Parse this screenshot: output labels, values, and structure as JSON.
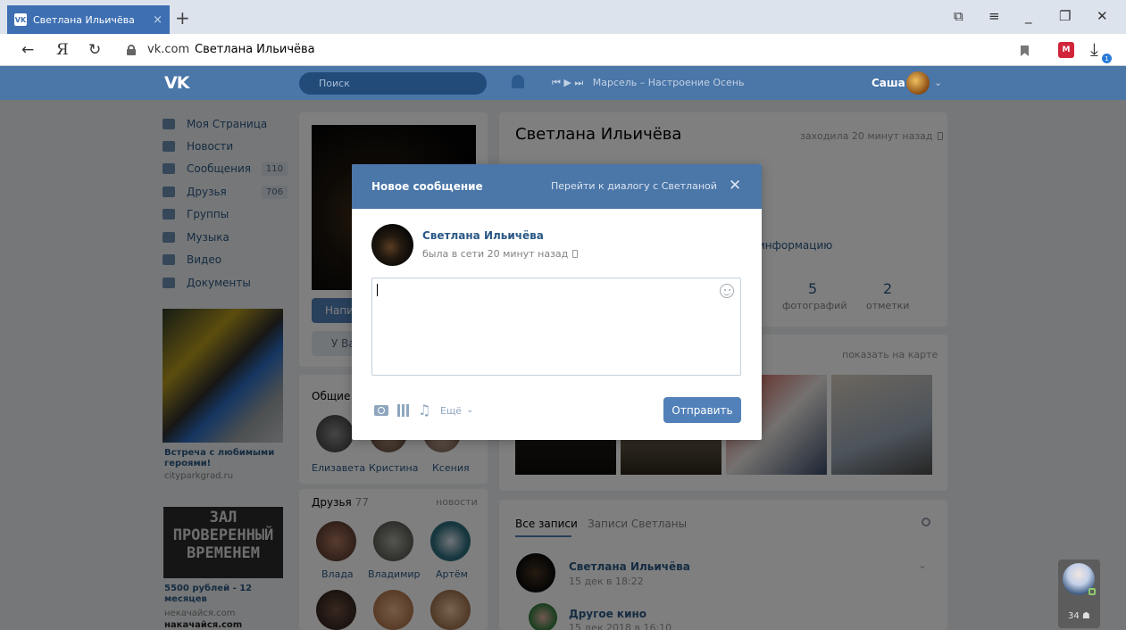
{
  "browser": {
    "tab_title": "Светлана Ильичёва",
    "tab_favicon": "VK",
    "tab_close": "×",
    "new_tab": "+",
    "url_domain": "vk.com",
    "url_title": "Светлана Ильичёва",
    "ext_label": "M",
    "download_badge": "1"
  },
  "vk": {
    "logo": "VK",
    "search_placeholder": "Поиск",
    "player_track": "Марсель – Настроение Осень",
    "user_name": "Саша",
    "menu": [
      {
        "label": "Моя Страница",
        "count": ""
      },
      {
        "label": "Новости",
        "count": ""
      },
      {
        "label": "Сообщения",
        "count": "110"
      },
      {
        "label": "Друзья",
        "count": "706"
      },
      {
        "label": "Группы",
        "count": ""
      },
      {
        "label": "Музыка",
        "count": ""
      },
      {
        "label": "Видео",
        "count": ""
      },
      {
        "label": "Документы",
        "count": ""
      }
    ],
    "ads": [
      {
        "title": "Встреча с любимыми героями!",
        "site": "cityparkgrad.ru"
      },
      {
        "title": "5500 рублей - 12 месяцев",
        "site": "некачайся.com",
        "site2": "накачайся.com",
        "img_text": "ЗАЛ ПРОВЕРЕННЫЙ ВРЕМЕНЕМ"
      }
    ],
    "profile": {
      "name": "Светлана Ильичёва",
      "online": "заходила 20 минут назад",
      "write_button": "Написать",
      "sec_button": "У Вас",
      "info_link": "информацию",
      "photos_count": "5",
      "photos_label": "фотографий",
      "marks_count": "2",
      "marks_label": "отметки",
      "map_link": "показать на карте"
    },
    "common_friends_title": "Общие д",
    "common_friends": [
      "Елизавета",
      "Кристина",
      "Ксения"
    ],
    "friends_title": "Друзья",
    "friends_count": "77",
    "friends_news": "новости",
    "friends": [
      "Влада",
      "Владимир",
      "Артём"
    ],
    "wall": {
      "tab_all": "Все записи",
      "tab_own": "Записи Светланы",
      "post_author": "Светлана Ильичёва",
      "post_date": "15 дек в 18:22",
      "repost_author": "Другое кино",
      "repost_date": "15 дек 2018 в 16:10"
    },
    "chat_count": "34"
  },
  "modal": {
    "title": "Новое сообщение",
    "goto_dialog": "Перейти к диалогу с Светланой",
    "close": "✕",
    "recipient_name": "Светлана Ильичёва",
    "recipient_status": "была в сети 20 минут назад",
    "message_value": "",
    "attach_more": "Ещё",
    "send_label": "Отправить"
  }
}
